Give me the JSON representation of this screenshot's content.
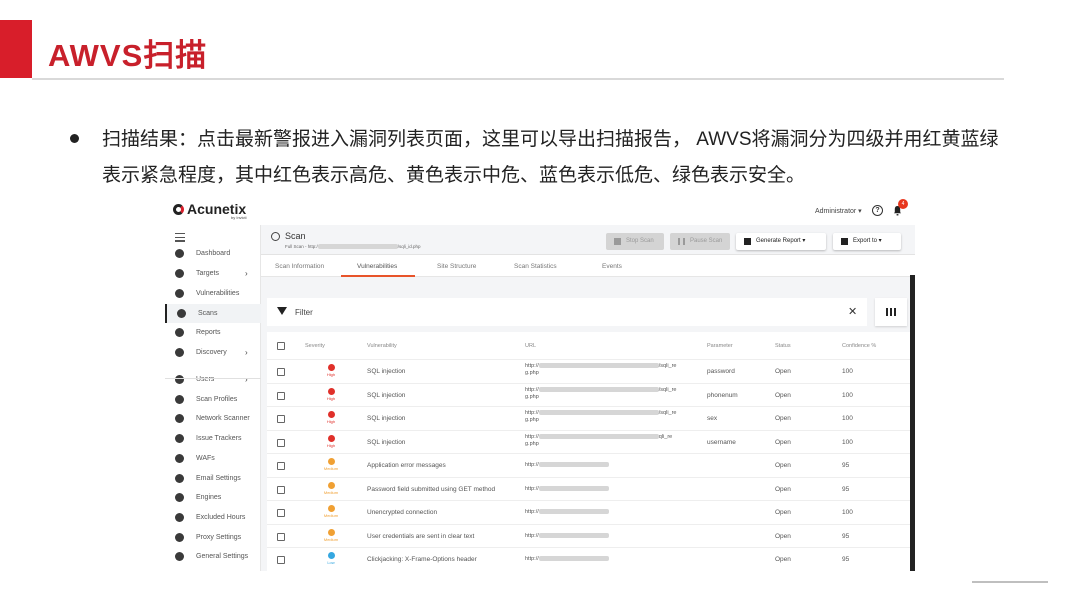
{
  "slide": {
    "title": "AWVS扫描",
    "bullet": "扫描结果：点击最新警报进入漏洞列表页面，这里可以导出扫描报告， AWVS将漏洞分为四级并用红黄蓝绿表示紧急程度，其中红色表示高危、黄色表示中危、蓝色表示低危、绿色表示安全。",
    "accent_color": "#d81e2a"
  },
  "app": {
    "logo": "Acunetix",
    "logo_sub": "by Invicti",
    "user": "Administrator ▾",
    "notification_count": "4"
  },
  "sidebar": {
    "items": [
      {
        "label": "Dashboard",
        "icon": "dashboard-icon"
      },
      {
        "label": "Targets",
        "icon": "target-icon",
        "chevron": "›"
      },
      {
        "label": "Vulnerabilities",
        "icon": "bug-icon"
      },
      {
        "label": "Scans",
        "icon": "scan-icon"
      },
      {
        "label": "Reports",
        "icon": "report-icon"
      },
      {
        "label": "Discovery",
        "icon": "compass-icon",
        "chevron": "›"
      },
      {
        "label": "Users",
        "icon": "users-icon",
        "chevron": "›"
      },
      {
        "label": "Scan Profiles",
        "icon": "shield-icon"
      },
      {
        "label": "Network Scanner",
        "icon": "network-icon"
      },
      {
        "label": "Issue Trackers",
        "icon": "tracker-icon"
      },
      {
        "label": "WAFs",
        "icon": "waf-icon"
      },
      {
        "label": "Email Settings",
        "icon": "bell-icon"
      },
      {
        "label": "Engines",
        "icon": "engine-icon"
      },
      {
        "label": "Excluded Hours",
        "icon": "clock-icon"
      },
      {
        "label": "Proxy Settings",
        "icon": "cloud-icon"
      },
      {
        "label": "General Settings",
        "icon": "gear-icon"
      }
    ]
  },
  "scan": {
    "title": "Scan",
    "subtitle_prefix": "Full Scan - http:/",
    "subtitle_suffix": "/sqli_id.php",
    "buttons": {
      "stop": "Stop Scan",
      "pause": "Pause Scan",
      "generate": "Generate Report ▾",
      "export": "Export to ▾"
    },
    "tabs": [
      "Scan Information",
      "Vulnerabilities",
      "Site Structure",
      "Scan Statistics",
      "Events"
    ]
  },
  "filter": {
    "label": "Filter"
  },
  "table": {
    "headers": [
      "Severity",
      "Vulnerability",
      "URL",
      "Parameter",
      "Status",
      "Confidence %"
    ],
    "rows": [
      {
        "severity": "High",
        "color": "#e0302a",
        "vuln": "SQL injection",
        "url1": "http://",
        "url1_tail": "/sqli_re",
        "url2": "g.php",
        "param": "password",
        "status": "Open",
        "conf": "100"
      },
      {
        "severity": "High",
        "color": "#e0302a",
        "vuln": "SQL injection",
        "url1": "http://",
        "url1_tail": "/sqli_re",
        "url2": "g.php",
        "param": "phonenum",
        "status": "Open",
        "conf": "100"
      },
      {
        "severity": "High",
        "color": "#e0302a",
        "vuln": "SQL injection",
        "url1": "http://",
        "url1_tail": "/sqli_re",
        "url2": "g.php",
        "param": "sex",
        "status": "Open",
        "conf": "100"
      },
      {
        "severity": "High",
        "color": "#e0302a",
        "vuln": "SQL injection",
        "url1": "http://",
        "url1_tail": "qli_re",
        "url2": "g.php",
        "param": "username",
        "status": "Open",
        "conf": "100"
      },
      {
        "severity": "Medium",
        "color": "#f0a033",
        "vuln": "Application error messages",
        "url1": "http://",
        "url1_tail": "",
        "url2": "",
        "param": "",
        "status": "Open",
        "conf": "95"
      },
      {
        "severity": "Medium",
        "color": "#f0a033",
        "vuln": "Password field submitted using GET method",
        "url1": "http://",
        "url1_tail": "",
        "url2": "",
        "param": "",
        "status": "Open",
        "conf": "95"
      },
      {
        "severity": "Medium",
        "color": "#f0a033",
        "vuln": "Unencrypted connection",
        "url1": "http://",
        "url1_tail": "",
        "url2": "",
        "param": "",
        "status": "Open",
        "conf": "100"
      },
      {
        "severity": "Medium",
        "color": "#f0a033",
        "vuln": "User credentials are sent in clear text",
        "url1": "http://",
        "url1_tail": "",
        "url2": "",
        "param": "",
        "status": "Open",
        "conf": "95"
      },
      {
        "severity": "Low",
        "color": "#35a7e0",
        "vuln": "Clickjacking: X-Frame-Options header",
        "url1": "http://",
        "url1_tail": "",
        "url2": "",
        "param": "",
        "status": "Open",
        "conf": "95"
      }
    ]
  }
}
